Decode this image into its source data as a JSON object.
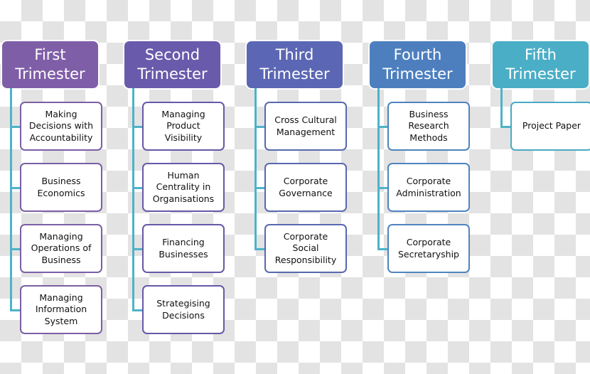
{
  "connector_color": "#4db3c9",
  "columns": [
    {
      "title": "First\nTrimester",
      "color": "#7f5ea8",
      "border": "#7a5fa5",
      "courses": [
        "Making\nDecisions with\nAccountability",
        "Business\nEconomics",
        "Managing\nOperations of\nBusiness",
        "Managing\nInformation\nSystem"
      ]
    },
    {
      "title": "Second\nTrimester",
      "color": "#6a5aab",
      "border": "#6658a8",
      "courses": [
        "Managing\nProduct\nVisibility",
        "Human\nCentrality in\nOrganisations",
        "Financing\nBusinesses",
        "Strategising\nDecisions"
      ]
    },
    {
      "title": "Third\nTrimester",
      "color": "#5b67b4",
      "border": "#5868b0",
      "courses": [
        "Cross Cultural\nManagement",
        "Corporate\nGovernance",
        "Corporate\nSocial\nResponsibility"
      ]
    },
    {
      "title": "Fourth\nTrimester",
      "color": "#4d7fbf",
      "border": "#4f84bf",
      "courses": [
        "Business\nResearch\nMethods",
        "Corporate\nAdministration",
        "Corporate\nSecretaryship"
      ]
    },
    {
      "title": "Fifth\nTrimester",
      "color": "#4aaec6",
      "border": "#4aa9c4",
      "courses": [
        "Project Paper"
      ]
    }
  ]
}
